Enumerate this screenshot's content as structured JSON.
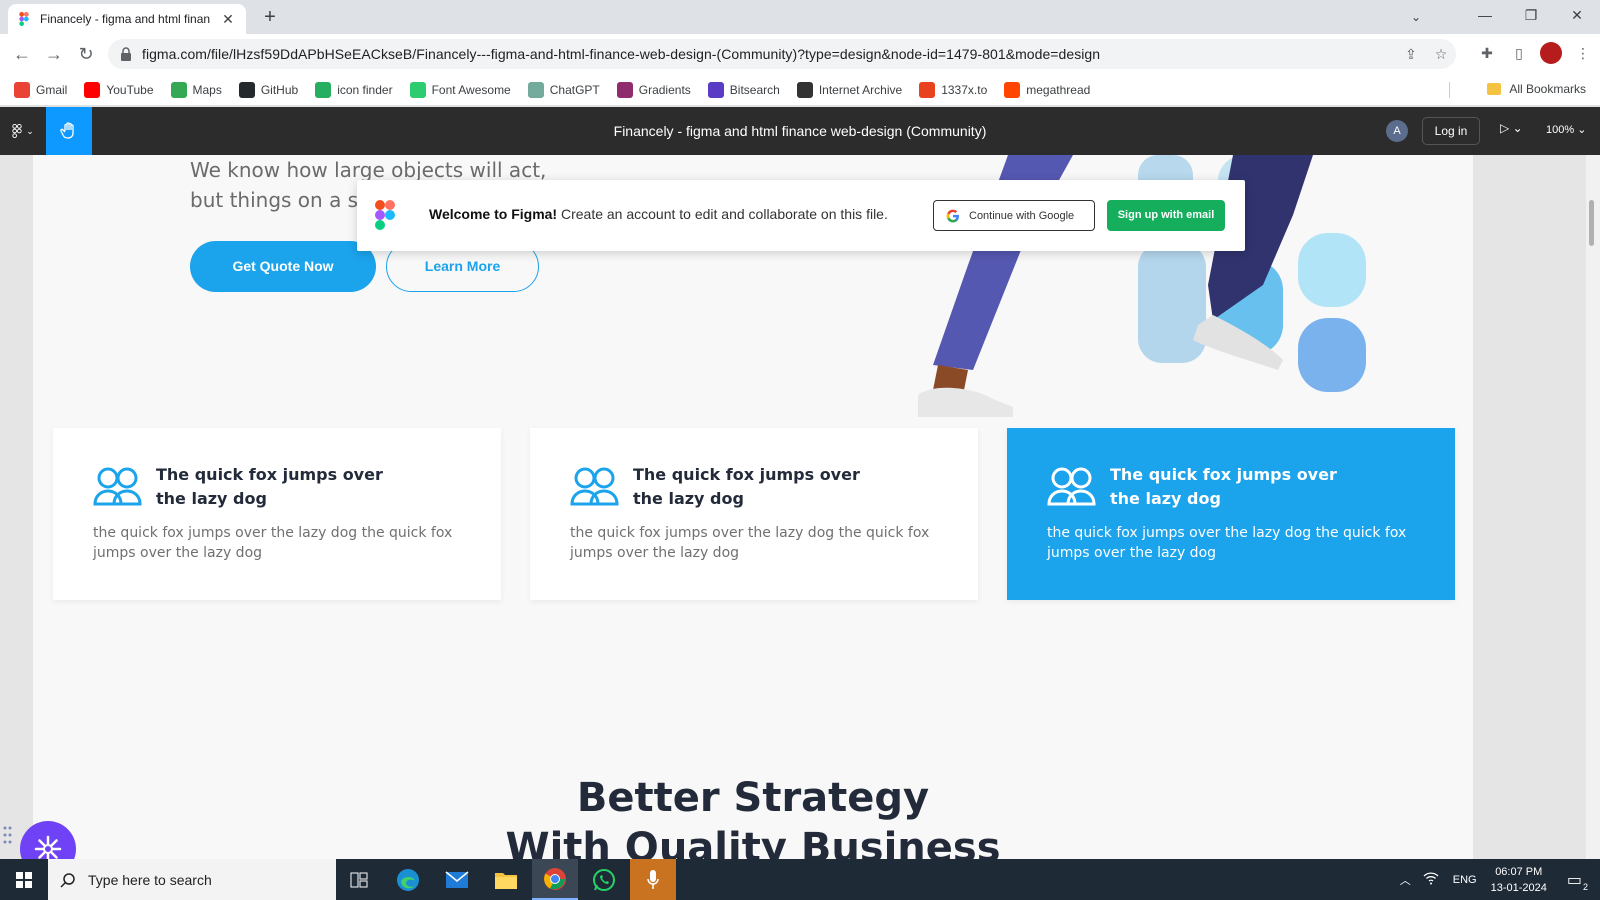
{
  "browser": {
    "tab_title": "Financely - figma and html finan",
    "url": "figma.com/file/lHzsf59DdAPbHSeEACkseB/Financely---figma-and-html-finance-web-design-(Community)?type=design&node-id=1479-801&mode=design",
    "bookmarks": [
      {
        "label": "Gmail",
        "icon": "gmail-icon",
        "color": "#ea4335"
      },
      {
        "label": "YouTube",
        "icon": "youtube-icon",
        "color": "#ff0000"
      },
      {
        "label": "Maps",
        "icon": "maps-icon",
        "color": "#34a853"
      },
      {
        "label": "GitHub",
        "icon": "github-icon",
        "color": "#24292e"
      },
      {
        "label": "icon finder",
        "icon": "iconfinder-icon",
        "color": "#27ae60"
      },
      {
        "label": "Font Awesome",
        "icon": "fontawesome-icon",
        "color": "#2ecc71"
      },
      {
        "label": "ChatGPT",
        "icon": "chatgpt-icon",
        "color": "#74aa9c"
      },
      {
        "label": "Gradients",
        "icon": "gradients-icon",
        "color": "#8e2c6e"
      },
      {
        "label": "Bitsearch",
        "icon": "bitsearch-icon",
        "color": "#5b3cc4"
      },
      {
        "label": "Internet Archive",
        "icon": "archive-icon",
        "color": "#333333"
      },
      {
        "label": "1337x.to",
        "icon": "1337x-icon",
        "color": "#e8421e"
      },
      {
        "label": "megathread",
        "icon": "reddit-icon",
        "color": "#ff4500"
      }
    ],
    "all_bookmarks": "All Bookmarks"
  },
  "figma": {
    "file_title": "Financely - figma and html finance web-design (Community)",
    "avatar_letter": "A",
    "login_label": "Log in",
    "zoom": "100%",
    "accent": "#0d99ff"
  },
  "design": {
    "hero_line1": "We know how large objects will act,",
    "hero_line2": "but things on a sma",
    "quote_button": "Get Quote Now",
    "learn_button": "Learn More",
    "cards": [
      {
        "title": "The quick fox jumps over the lazy dog",
        "body": "the quick fox jumps over the lazy dog the quick fox jumps over the lazy dog",
        "highlight": false
      },
      {
        "title": "The quick fox jumps over the lazy dog",
        "body": "the quick fox jumps over the lazy dog the quick fox jumps over the lazy dog",
        "highlight": false
      },
      {
        "title": "The quick fox jumps over the lazy dog",
        "body": "the quick fox jumps over the lazy dog the quick fox jumps over the lazy dog",
        "highlight": true
      }
    ],
    "strategy_heading": "Better Strategy",
    "strategy_heading_2": "With Quality Business",
    "accent": "#1ba3ec"
  },
  "welcome": {
    "bold": "Welcome to Figma!",
    "text": " Create an account to edit and collaborate on this file.",
    "google_button": "Continue with Google",
    "signup_button": "Sign up with email",
    "signup_color": "#14ae5c"
  },
  "taskbar": {
    "search_placeholder": "Type here to search",
    "language": "ENG",
    "time": "06:07 PM",
    "date": "13-01-2024",
    "notifications": "2"
  }
}
